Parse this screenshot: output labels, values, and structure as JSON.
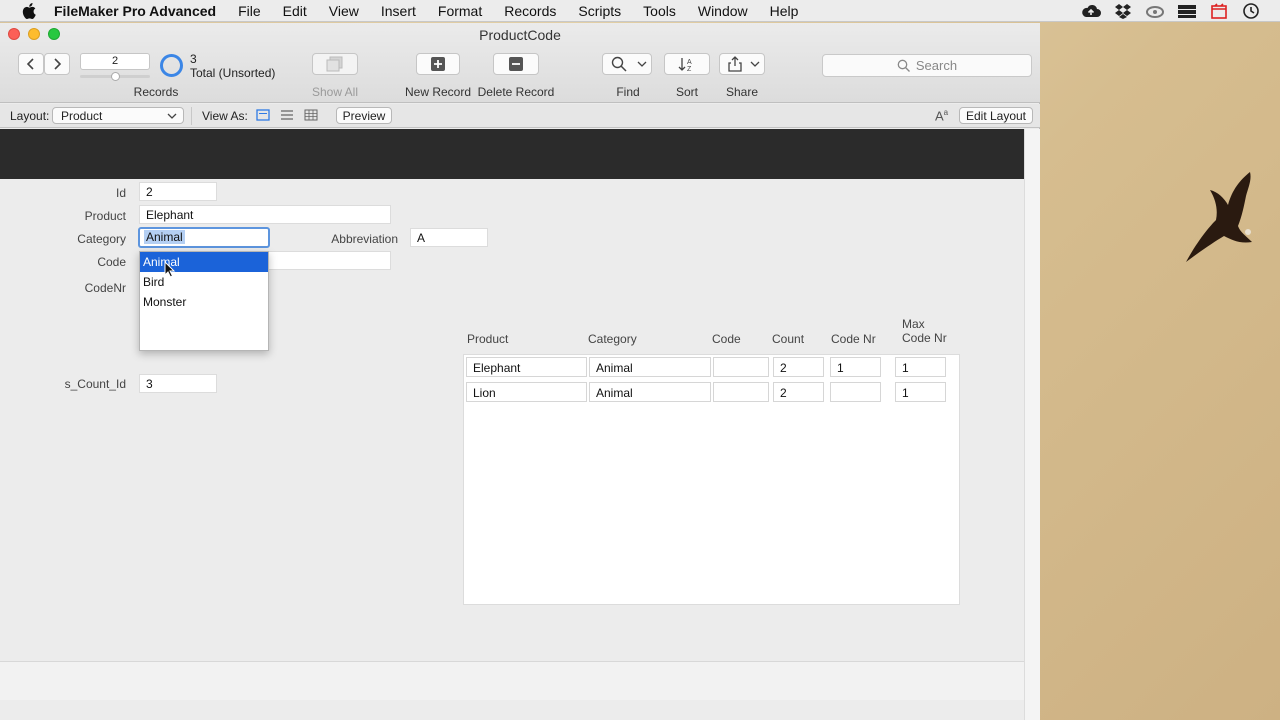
{
  "menubar": {
    "app_name": "FileMaker Pro Advanced",
    "items": [
      "File",
      "Edit",
      "View",
      "Insert",
      "Format",
      "Records",
      "Scripts",
      "Tools",
      "Window",
      "Help"
    ],
    "tray_icons": [
      "cloud-upload-icon",
      "dropbox-icon",
      "creative-cloud-icon",
      "drive-icon",
      "screen-record-icon",
      "time-machine-icon"
    ]
  },
  "window": {
    "title": "ProductCode"
  },
  "toolbar": {
    "record_number": "2",
    "found_count": "3",
    "total_label": "Total (Unsorted)",
    "records_label": "Records",
    "show_all_label": "Show All",
    "new_record_label": "New Record",
    "delete_record_label": "Delete Record",
    "find_label": "Find",
    "sort_label": "Sort",
    "share_label": "Share",
    "search_placeholder": "Search"
  },
  "layoutbar": {
    "layout_label": "Layout:",
    "layout_value": "Product",
    "view_as_label": "View As:",
    "preview_label": "Preview",
    "edit_layout_label": "Edit Layout"
  },
  "form": {
    "id_label": "Id",
    "id_value": "2",
    "product_label": "Product",
    "product_value": "Elephant",
    "category_label": "Category",
    "category_value": "Animal",
    "abbreviation_label": "Abbreviation",
    "abbreviation_value": "A",
    "code_label": "Code",
    "codenr_label": "CodeNr",
    "s_count_id_label": "s_Count_Id",
    "s_count_id_value": "3"
  },
  "dropdown": {
    "options": [
      "Animal",
      "Bird",
      "Monster"
    ],
    "selected_index": 0
  },
  "portal": {
    "headers": {
      "product": "Product",
      "category": "Category",
      "code": "Code",
      "count": "Count",
      "code_nr": "Code Nr",
      "max_code_nr_1": "Max",
      "max_code_nr_2": "Code Nr"
    },
    "rows": [
      {
        "product": "Elephant",
        "category": "Animal",
        "code": "",
        "count": "2",
        "code_nr": "1",
        "max_code_nr": "1"
      },
      {
        "product": "Lion",
        "category": "Animal",
        "code": "",
        "count": "2",
        "code_nr": "",
        "max_code_nr": "1"
      }
    ]
  },
  "colors": {
    "selection_blue": "#1b63d9",
    "focus_ring": "#5d95de",
    "header_band": "#2b2b2b"
  }
}
